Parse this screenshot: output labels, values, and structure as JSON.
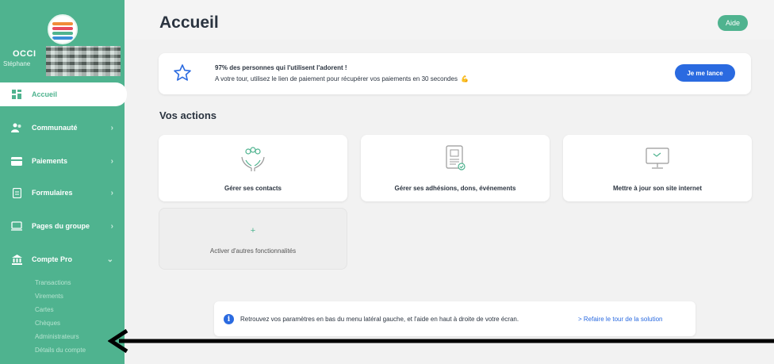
{
  "sidebar": {
    "org_name": "OCCI",
    "user_name": "Stéphane",
    "nav": [
      {
        "label": "Accueil",
        "icon": "dashboard-icon",
        "active": true
      },
      {
        "label": "Communauté",
        "icon": "community-icon"
      },
      {
        "label": "Paiements",
        "icon": "payment-card-icon"
      },
      {
        "label": "Formulaires",
        "icon": "form-icon"
      },
      {
        "label": "Pages du groupe",
        "icon": "screen-icon"
      },
      {
        "label": "Compte Pro",
        "icon": "bank-icon"
      }
    ],
    "sub_items": [
      "Transactions",
      "Virements",
      "Cartes",
      "Chèques",
      "Administrateurs",
      "Détails du compte"
    ]
  },
  "header": {
    "title": "Accueil",
    "help_label": "Aide"
  },
  "banner": {
    "line1": "97% des personnes qui l'utilisent l'adorent !",
    "line2": "A votre tour, utilisez le lien de paiement pour récupérer vos paiements en 30 secondes",
    "button": "Je me lance"
  },
  "actions": {
    "title": "Vos actions",
    "cards": [
      {
        "label": "Gérer ses contacts",
        "icon": "contacts-hands-icon"
      },
      {
        "label": "Gérer ses adhésions, dons, événements",
        "icon": "document-check-icon"
      },
      {
        "label": "Mettre à jour son site internet",
        "icon": "monitor-icon"
      }
    ],
    "add_card": {
      "plus": "+",
      "label": "Activer d'autres fonctionnalités"
    }
  },
  "tip": {
    "message": "Retrouvez vos paramètres en bas du menu latéral gauche, et l'aide en haut à droite de votre écran.",
    "link": "> Refaire le tour de la solution"
  },
  "colors": {
    "sidebar": "#4fb38f",
    "primary_blue": "#2a6ae0",
    "background": "#f2f2f2"
  }
}
